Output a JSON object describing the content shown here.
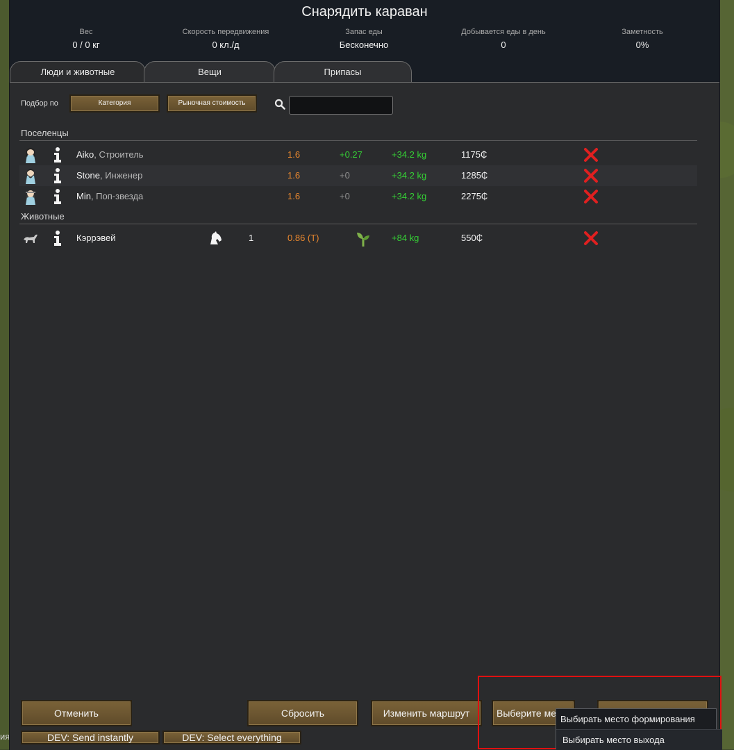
{
  "window": {
    "title": "Снарядить караван"
  },
  "stats": [
    {
      "label": "Вес",
      "value": "0 / 0 кг"
    },
    {
      "label": "Скорость передвижения",
      "value": "0 кл./д"
    },
    {
      "label": "Запас еды",
      "value": "Бесконечно"
    },
    {
      "label": "Добывается еды в день",
      "value": "0"
    },
    {
      "label": "Заметность",
      "value": "0%"
    }
  ],
  "tabs": [
    {
      "label": "Люди и животные",
      "active": true
    },
    {
      "label": "Вещи",
      "active": false
    },
    {
      "label": "Припасы",
      "active": false
    }
  ],
  "sort": {
    "label": "Подбор по",
    "category_button": "Категория",
    "market_value_button": "Рыночная стоимость",
    "search_value": ""
  },
  "colonists_section": "Поселенцы",
  "colonists": [
    {
      "name": "Aiko",
      "role": ", Строитель",
      "speed": "1.6",
      "food": "+0.27",
      "mass": "+34.2 kg",
      "value": "1175₵"
    },
    {
      "name": "Stone",
      "role": ", Инженер",
      "speed": "1.6",
      "food": "+0",
      "mass": "+34.2 kg",
      "value": "1285₵"
    },
    {
      "name": "Min",
      "role": ", Поп-звезда",
      "speed": "1.6",
      "food": "+0",
      "mass": "+34.2 kg",
      "value": "2275₵"
    }
  ],
  "animals_section": "Животные",
  "animals": [
    {
      "name": "Кэррэвей",
      "count": "1",
      "speed": "0.86 (T)",
      "mass": "+84 kg",
      "value": "550₵"
    }
  ],
  "footer": {
    "cancel": "Отменить",
    "reset": "Сбросить",
    "change_route": "Изменить маршрут",
    "choose_place": "Выберите ме",
    "dev_send": "DEV: Send instantly",
    "dev_select": "DEV: Select everything"
  },
  "dropdown": {
    "items": [
      "Выбирать место формирования",
      "Выбирать место выхода"
    ]
  },
  "edge_text": "ия",
  "colors": {
    "food_positive": "#35d035",
    "speed": "#e8872e",
    "remove": "#e02020",
    "highlight_frame": "#e01010"
  }
}
